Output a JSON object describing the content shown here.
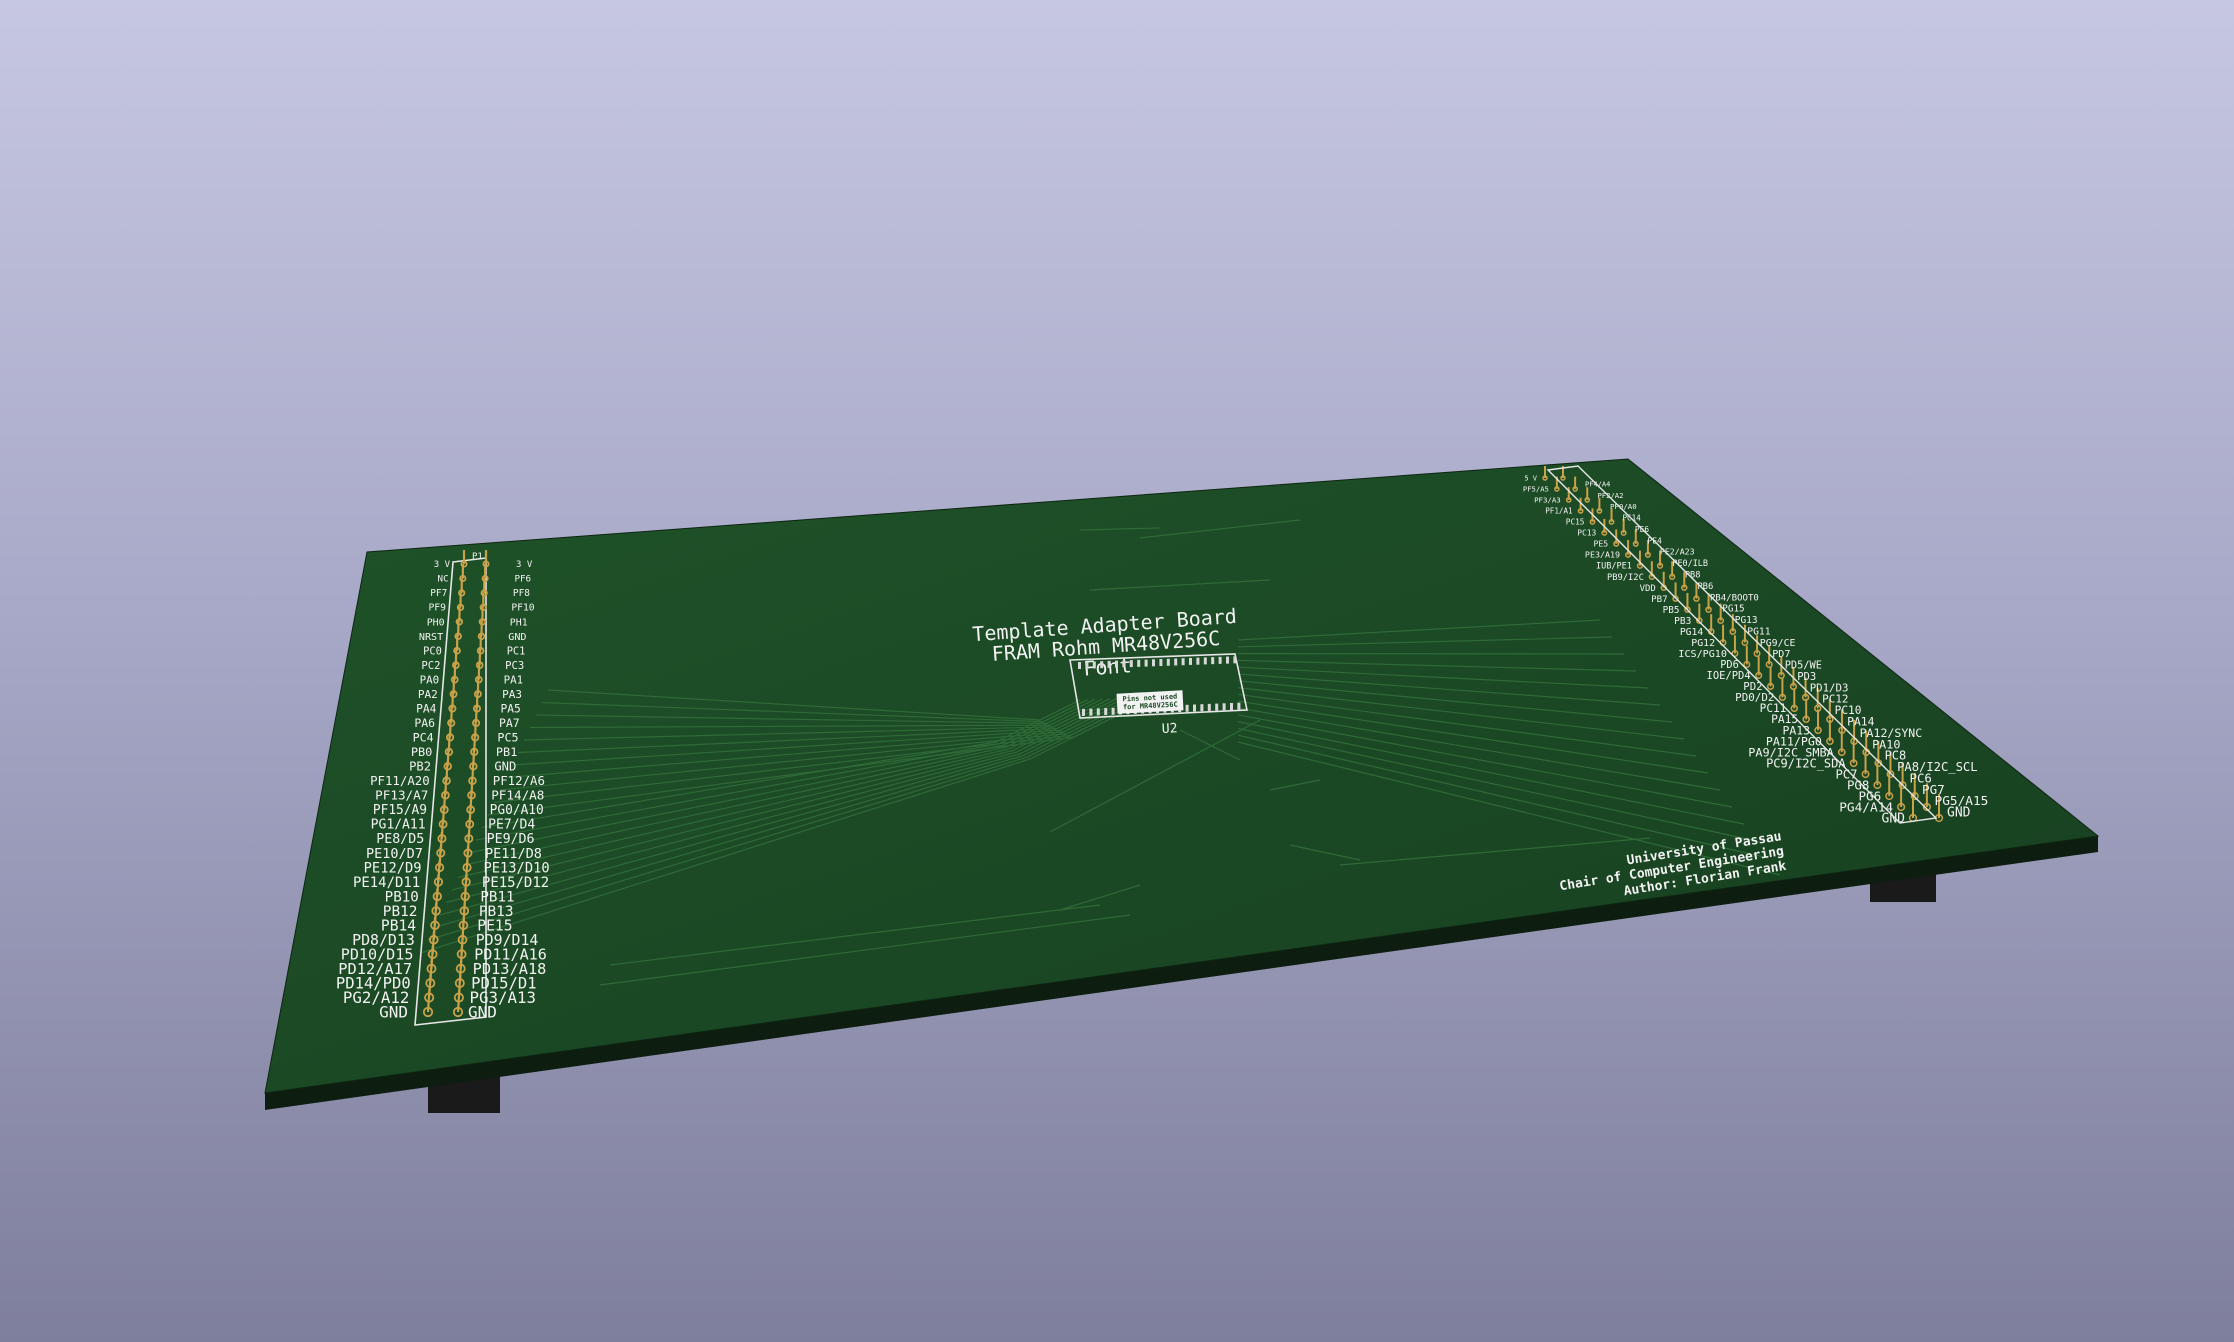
{
  "board": {
    "title_lines": [
      "Template Adapter Board",
      "FRAM Rohm MR48V256C",
      "Font"
    ],
    "chip_ref": "U2",
    "chip_note": [
      "Pins not used",
      "for MR48V256C"
    ],
    "credits": [
      "University of Passau",
      "Chair of Computer Engineering",
      "Author: Florian Frank"
    ],
    "colors": {
      "pcb": "#1b4a26",
      "silkscreen": "#f2f2f2",
      "pin": "#c9a24a",
      "background": "#b4b5d0"
    }
  },
  "left_header": {
    "ref": "P1",
    "outer_labels": [
      "3 V",
      "NC",
      "PF7",
      "PF9",
      "PH0",
      "NRST",
      "PC0",
      "PC2",
      "PA0",
      "PA2",
      "PA4",
      "PA6",
      "PC4",
      "PB0",
      "PB2",
      "PF11/A20",
      "PF13/A7",
      "PF15/A9",
      "PG1/A11",
      "PE8/D5",
      "PE10/D7",
      "PE12/D9",
      "PE14/D11",
      "PB10",
      "PB12",
      "PB14",
      "PD8/D13",
      "PD10/D15",
      "PD12/A17",
      "PD14/PD0",
      "PG2/A12",
      "GND"
    ],
    "inner_labels": [
      "3 V",
      "PF6",
      "PF8",
      "PF10",
      "PH1",
      "GND",
      "PC1",
      "PC3",
      "PA1",
      "PA3",
      "PA5",
      "PA7",
      "PC5",
      "PB1",
      "GND",
      "PF12/A6",
      "PF14/A8",
      "PG0/A10",
      "PE7/D4",
      "PE9/D6",
      "PE11/D8",
      "PE13/D10",
      "PE15/D12",
      "PB11",
      "PB13",
      "PE15",
      "PD9/D14",
      "PD11/A16",
      "PD13/A18",
      "PD15/D1",
      "PG3/A13",
      "GND"
    ]
  },
  "right_header": {
    "inner_labels": [
      "5 V",
      "PF5/A5",
      "PF3/A3",
      "PF1/A1",
      "PC15",
      "PC13",
      "PE5",
      "PE3/A19",
      "IUB/PE1",
      "PB9/I2C",
      "VDD",
      "PB7",
      "PB5",
      "PB3",
      "PG14",
      "PG12",
      "ICS/PG10",
      "PD6",
      "IOE/PD4",
      "PD2",
      "PD0/D2",
      "PC11",
      "PA15",
      "PA13",
      "PA11/PG0",
      "PA9/I2C_SMBA",
      "PC9/I2C_SDA",
      "PC7",
      "PG8",
      "PG6",
      "PG4/A14",
      "GND"
    ],
    "outer_labels": [
      "PF4/A4",
      "PF2/A2",
      "PF0/A0",
      "PC14",
      "PE6",
      "PE4",
      "PE2/A23",
      "PE0/ILB",
      "PB8",
      "PB6",
      "PB4/BOOT0",
      "PG15",
      "PG13",
      "PG11",
      "PG9/CE",
      "PD7",
      "PD5/WE",
      "PD3",
      "PD1/D3",
      "PC12",
      "PC10",
      "PA14",
      "PA12/SYNC",
      "PA10",
      "PC8",
      "PA8/I2C_SCL",
      "PC6",
      "PG7",
      "PG5/A15",
      "GND"
    ]
  }
}
